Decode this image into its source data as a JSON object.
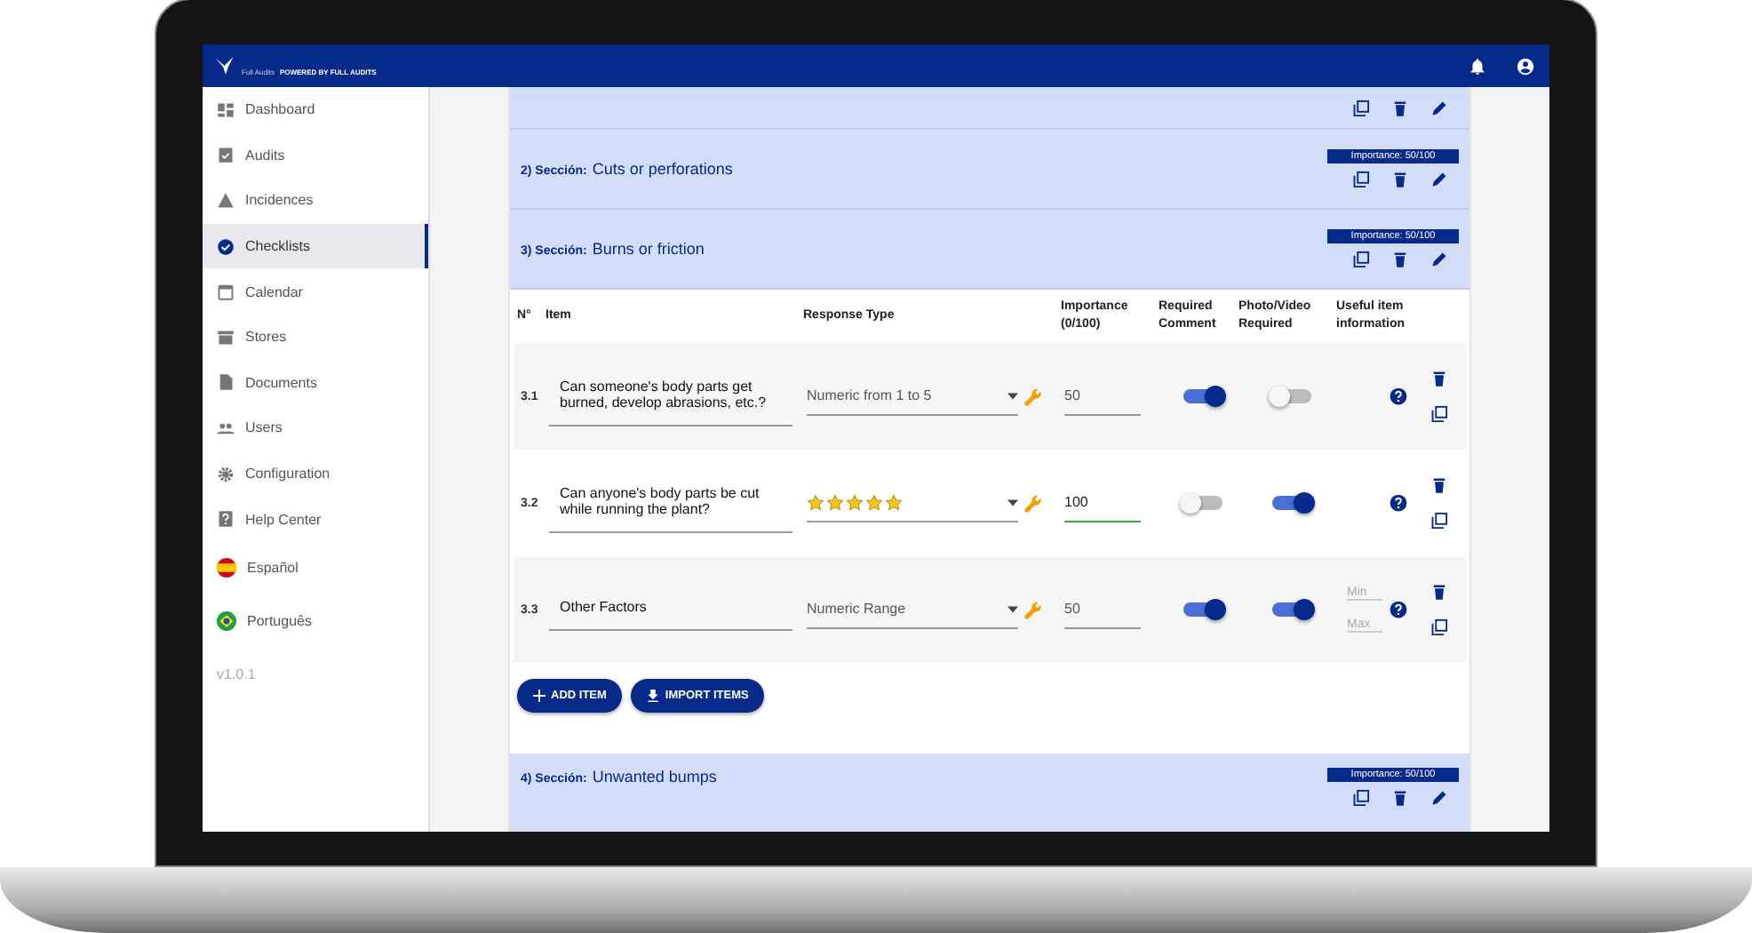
{
  "header": {
    "logo_text": "Full Audits",
    "tagline": "POWERED BY FULL AUDITS"
  },
  "sidebar": {
    "items": [
      {
        "label": "Dashboard",
        "selected": false
      },
      {
        "label": "Audits",
        "selected": false
      },
      {
        "label": "Incidences",
        "selected": false
      },
      {
        "label": "Checklists",
        "selected": true
      },
      {
        "label": "Calendar",
        "selected": false
      },
      {
        "label": "Stores",
        "selected": false
      },
      {
        "label": "Documents",
        "selected": false
      },
      {
        "label": "Users",
        "selected": false
      },
      {
        "label": "Configuration",
        "selected": false
      },
      {
        "label": "Help Center",
        "selected": false
      }
    ],
    "languages": [
      {
        "label": "Español",
        "kind": "es"
      },
      {
        "label": "Português",
        "kind": "pt"
      }
    ],
    "version": "v1.0.1"
  },
  "sections_before": [
    {
      "kind": "scrolled_off"
    },
    {
      "kind": "full",
      "prefix": "2) Sección:",
      "title": "Cuts or perforations",
      "importance": "Importance: 50/100"
    }
  ],
  "open_section": {
    "prefix": "3) Sección:",
    "title": "Burns or friction",
    "importance": "Importance: 50/100",
    "columns": [
      "N°",
      "Item",
      "Response Type",
      "Importance (0/100)",
      "Required Comment",
      "Photo/Video Required",
      "Useful item information"
    ],
    "rows": [
      {
        "number": "3.1",
        "item": "Can someone's body parts get burned, develop abrasions, etc.?",
        "response": {
          "kind": "text",
          "text": "Numeric from 1 to 5"
        },
        "importance": "50",
        "focused": false,
        "required_comment": true,
        "photo_required": false,
        "range": null
      },
      {
        "number": "3.2",
        "item": "Can anyone's body parts be cut while running the plant?",
        "response": {
          "kind": "stars",
          "stars": 5
        },
        "importance": "100",
        "focused": true,
        "required_comment": false,
        "photo_required": true,
        "range": null
      },
      {
        "number": "3.3",
        "item": "Other Factors",
        "response": {
          "kind": "text",
          "text": "Numeric Range"
        },
        "importance": "50",
        "focused": false,
        "required_comment": true,
        "photo_required": true,
        "range": {
          "min_placeholder": "Min",
          "max_placeholder": "Max"
        }
      }
    ],
    "buttons": [
      {
        "label": "ADD ITEM",
        "kind": "add"
      },
      {
        "label": "IMPORT ITEMS",
        "kind": "import"
      }
    ]
  },
  "sections_after": [
    {
      "prefix": "4) Sección:",
      "title": "Unwanted bumps",
      "importance": "Importance: 50/100"
    }
  ]
}
